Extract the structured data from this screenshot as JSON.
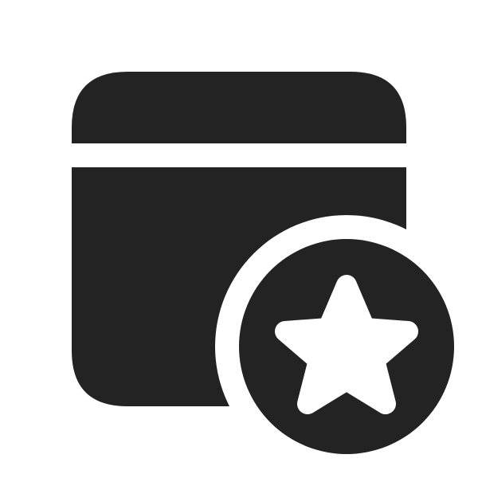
{
  "icon": {
    "name": "calendar-star-icon",
    "parts": [
      "window-header-icon",
      "window-body-icon",
      "star-badge-icon"
    ]
  },
  "colors": {
    "background": "#ffffff",
    "glyph": "#232323",
    "cutout": "#ffffff"
  }
}
